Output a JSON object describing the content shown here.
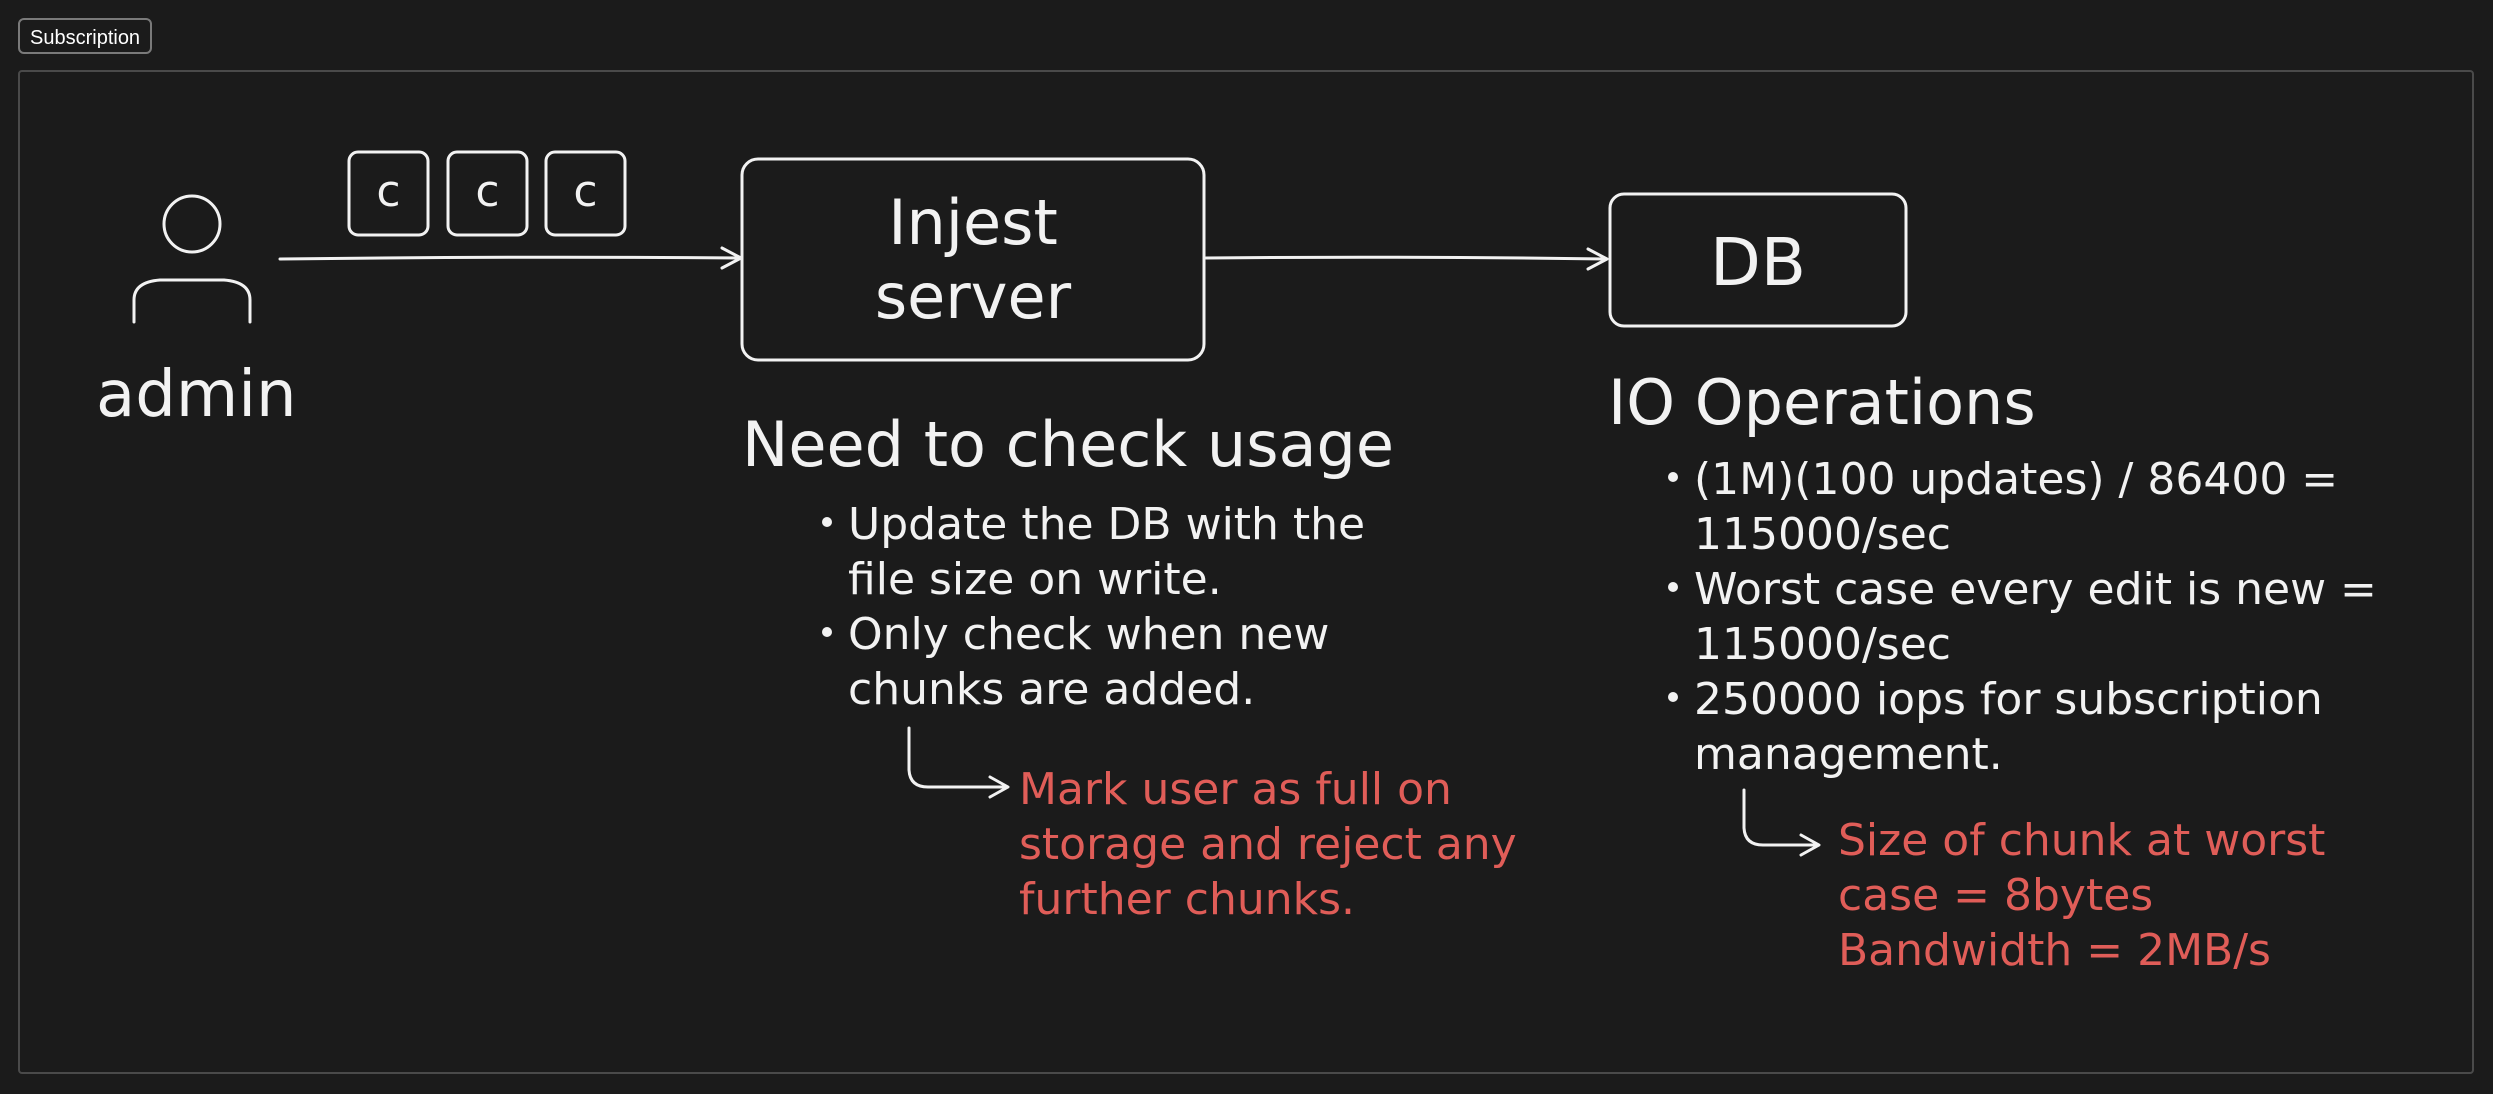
{
  "frame": {
    "label": "Subscription"
  },
  "actor": {
    "label": "admin"
  },
  "chunks": [
    "c",
    "c",
    "c"
  ],
  "injest": {
    "line1": "Injest",
    "line2": "server"
  },
  "db": {
    "label": "DB"
  },
  "usage": {
    "title": "Need to check usage",
    "bullets": [
      {
        "line1": "Update the DB with the",
        "line2": "file size on write."
      },
      {
        "line1": "Only check when new",
        "line2": "chunks are added."
      }
    ],
    "note": [
      "Mark user as full on",
      "storage and reject any",
      "further chunks."
    ]
  },
  "io": {
    "title": "IO Operations",
    "bullets": [
      {
        "line1": "(1M)(100 updates) / 86400 =",
        "line2": "115000/sec"
      },
      {
        "line1": "Worst case every edit is new =",
        "line2": "115000/sec"
      },
      {
        "line1": "250000 iops for subscription",
        "line2": "management."
      }
    ],
    "note": [
      "Size of chunk at worst",
      "case = 8bytes",
      "Bandwidth = 2MB/s"
    ]
  },
  "colors": {
    "background": "#1b1b1b",
    "stroke": "#f2f2f2",
    "accent": "#e05d58"
  }
}
